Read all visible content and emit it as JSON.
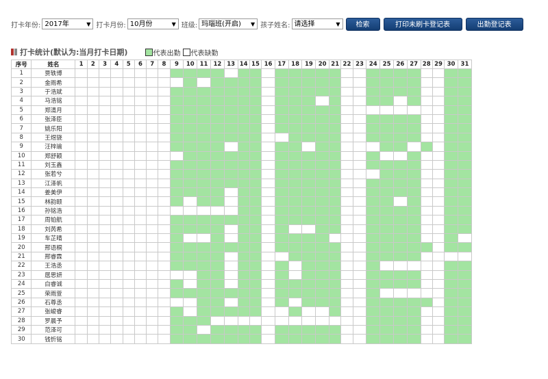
{
  "filters": {
    "year_label": "打卡年份:",
    "year_value": "2017年",
    "month_label": "打卡月份:",
    "month_value": "10月份",
    "class_label": "班级:",
    "class_value": "玛瑙班(开启)",
    "child_label": "孩子姓名:",
    "child_value": "请选择"
  },
  "buttons": {
    "search": "检索",
    "print_unswiped": "打印未刷卡登记表",
    "attendance": "出勤登记表"
  },
  "section": {
    "title": "打卡统计(默认为:当月打卡日期)",
    "legend_present": "代表出勤",
    "legend_absent": "代表缺勤"
  },
  "colors": {
    "present": "#a3e4a1",
    "absent": "#ffffff",
    "button": "#1f4d86"
  },
  "table": {
    "header_index": "序号",
    "header_name": "姓名",
    "days": [
      1,
      2,
      3,
      4,
      5,
      6,
      7,
      8,
      9,
      10,
      11,
      12,
      13,
      14,
      15,
      16,
      17,
      18,
      19,
      20,
      21,
      22,
      23,
      24,
      25,
      26,
      27,
      28,
      29,
      30,
      31
    ],
    "rows": [
      {
        "idx": 1,
        "name": "贾轶博",
        "att": "00000000111101101111100111100111"
      },
      {
        "idx": 2,
        "name": "金雨希",
        "att": "00000000010111101111100111100111"
      },
      {
        "idx": 3,
        "name": "于浩斌",
        "att": "00000000111111101111100111100110"
      },
      {
        "idx": 4,
        "name": "马浩铭",
        "att": "00000000111111101110100110100111"
      },
      {
        "idx": 5,
        "name": "郑清月",
        "att": "00000000111111101111100000000110"
      },
      {
        "idx": 6,
        "name": "张泽臣",
        "att": "00000000111111101111100111100111"
      },
      {
        "idx": 7,
        "name": "姚乐阳",
        "att": "00000000111111101111100111100111"
      },
      {
        "idx": 8,
        "name": "王煜骁",
        "att": "00000000111111100111100111100111"
      },
      {
        "idx": 9,
        "name": "汪梓瑜",
        "att": "00000000111101101101100011010110"
      },
      {
        "idx": 10,
        "name": "郑舒颖",
        "att": "00000000011111101111100100100111"
      },
      {
        "idx": 11,
        "name": "刘玉鑫",
        "att": "00000000111111101111100111100111"
      },
      {
        "idx": 12,
        "name": "张若兮",
        "att": "00000000111111101111100011100111"
      },
      {
        "idx": 13,
        "name": "江泽帆",
        "att": "00000000111111101111100111100110"
      },
      {
        "idx": 14,
        "name": "姜美伊",
        "att": "00000000111101101111100111100111"
      },
      {
        "idx": 15,
        "name": "林韵颐",
        "att": "00000000101101101111100110100111"
      },
      {
        "idx": 16,
        "name": "孙铭浩",
        "att": "00000000000001101111100111100111"
      },
      {
        "idx": 17,
        "name": "周铂航",
        "att": "00000000111111101111100111100111"
      },
      {
        "idx": 18,
        "name": "刘芮希",
        "att": "00000000111101101001100111100111"
      },
      {
        "idx": 19,
        "name": "车芷晴",
        "att": "00000000100101101111000111100101"
      },
      {
        "idx": 20,
        "name": "邢语桐",
        "att": "00000000111111101111100111110111"
      },
      {
        "idx": 21,
        "name": "邢睿霖",
        "att": "00000000111101100111100111100000"
      },
      {
        "idx": 22,
        "name": "王浩丞",
        "att": "00000000111101101011100100000110"
      },
      {
        "idx": 23,
        "name": "居思妍",
        "att": "00000000001101101011100111100111"
      },
      {
        "idx": 24,
        "name": "白睿诚",
        "att": "00000000101101101111100111100110"
      },
      {
        "idx": 25,
        "name": "荣雨萱",
        "att": "00000000111111101111100100000111"
      },
      {
        "idx": 26,
        "name": "石尊丞",
        "att": "00000000001101101011100111110111"
      },
      {
        "idx": 27,
        "name": "张峻睿",
        "att": "00000000101111100100100111100111"
      },
      {
        "idx": 28,
        "name": "罗晨予",
        "att": "00000000111000000000000111100111"
      },
      {
        "idx": 29,
        "name": "范泽可",
        "att": "00000000110111101111100111100111"
      },
      {
        "idx": 30,
        "name": "钱忻铭",
        "att": "00000000111111101111100111100111"
      }
    ]
  }
}
